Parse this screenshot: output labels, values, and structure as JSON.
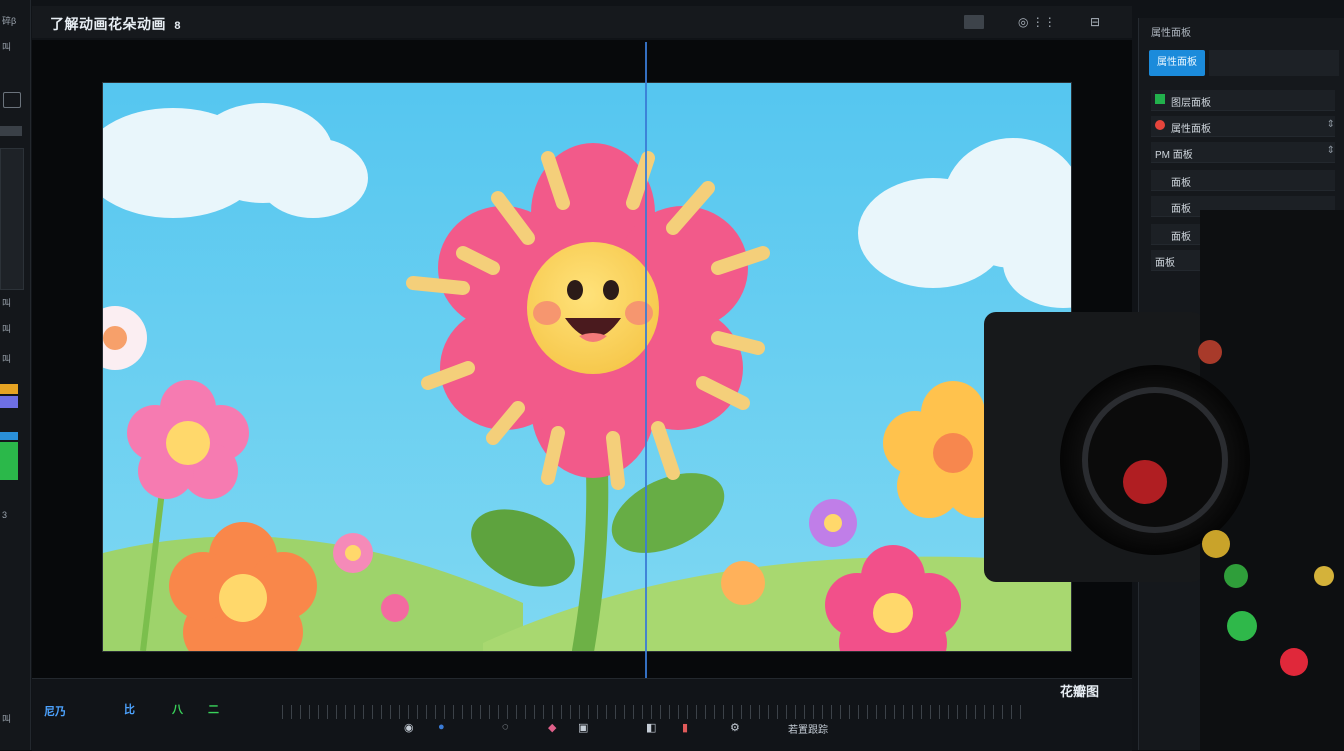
{
  "window": {
    "title": "了解动画花朵动画",
    "title_suffix": "8"
  },
  "left_rail": {
    "labels": [
      "碎β",
      "叫",
      "□",
      "叫",
      "3",
      "叫"
    ]
  },
  "toolbar": {
    "icons": [
      "layout-icon",
      "view-icon",
      "export-icon"
    ]
  },
  "right_panel": {
    "header": "属性面板",
    "primary_button": "属性面板",
    "field_value": "",
    "rows": [
      {
        "label": "图层面板"
      },
      {
        "label": "属性面板"
      },
      {
        "label": "PM 面板"
      },
      {
        "label": "面板"
      },
      {
        "label": "面板"
      },
      {
        "label": "面板"
      },
      {
        "label": "面板"
      }
    ]
  },
  "timeline": {
    "left_labels": [
      "尼乃",
      "比",
      "八",
      "二"
    ],
    "right_label": "花瓣图",
    "transport_label": "若置跟踪"
  },
  "colors": {
    "accent": "#1b8bdb",
    "playhead": "#3a7bd5",
    "sky_top": "#6ad0f4",
    "petal": "#f0507f"
  }
}
